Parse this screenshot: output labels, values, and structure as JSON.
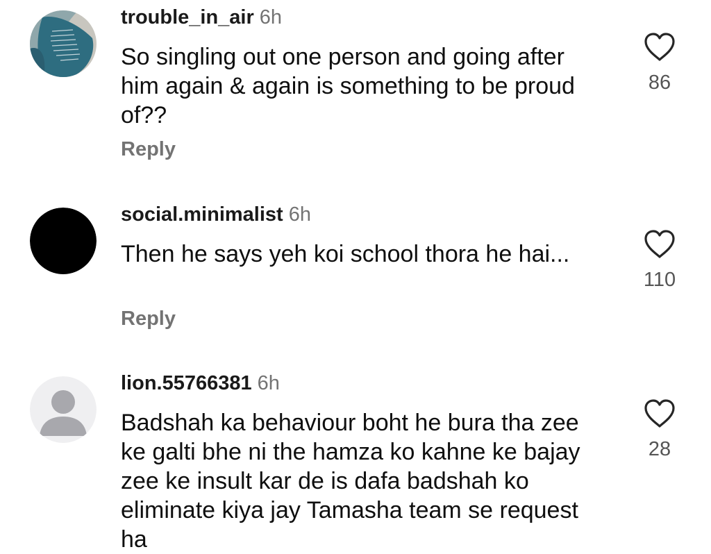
{
  "comments": [
    {
      "username": "trouble_in_air",
      "time": "6h",
      "text": "So singling out one person and going after him again & again is something to be proud of??",
      "reply_label": "Reply",
      "likes": "86",
      "avatar": "teal-artwork-avatar"
    },
    {
      "username": "social.minimalist",
      "time": "6h",
      "text": "Then he says yeh koi school thora he hai...",
      "reply_label": "Reply",
      "likes": "110",
      "avatar": "black-circle-avatar"
    },
    {
      "username": "lion.55766381",
      "time": "6h",
      "text": "Badshah ka behaviour boht he bura tha zee ke galti bhe ni the hamza ko kahne ke bajay zee ke insult kar de is dafa badshah ko eliminate kiya jay Tamasha team se request ha",
      "likes": "28",
      "avatar": "default-user-avatar"
    }
  ],
  "colors": {
    "secondary_text": "#737373",
    "primary_text": "#0f0f0f",
    "avatar_teal": "#2f6f7f",
    "avatar_default_bg": "#efeff1",
    "avatar_default_fg": "#a8a8ad"
  },
  "icons": {
    "like": "heart-outline-icon"
  }
}
